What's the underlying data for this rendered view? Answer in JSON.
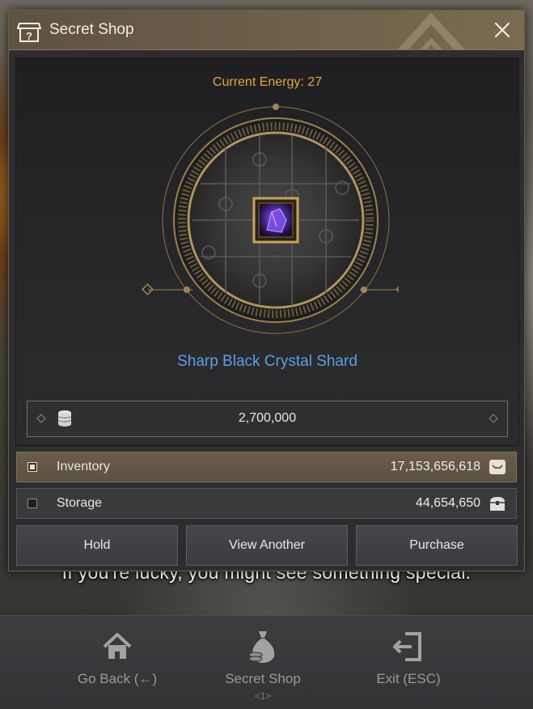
{
  "window": {
    "title": "Secret Shop",
    "title_icon": "shop-icon",
    "close_icon": "close-icon"
  },
  "shop": {
    "energy_label": "Current Energy: 27",
    "item_name": "Sharp Black Crystal Shard",
    "item_icon": "crystal-shard-icon",
    "price": "2,700,000",
    "price_icon": "silver-coins-icon"
  },
  "payment": {
    "inventory": {
      "label": "Inventory",
      "amount": "17,153,656,618",
      "checked": true,
      "icon": "inventory-bag-icon"
    },
    "storage": {
      "label": "Storage",
      "amount": "44,654,650",
      "checked": false,
      "icon": "storage-chest-icon"
    }
  },
  "buttons": {
    "hold": "Hold",
    "view_another": "View Another",
    "purchase": "Purchase"
  },
  "subtitle": "If you're lucky, you might see something special.",
  "bottom_bar": [
    {
      "label": "Go Back (←)",
      "icon": "home-icon"
    },
    {
      "label": "Secret Shop",
      "icon": "money-bag-icon",
      "sub": "<1>"
    },
    {
      "label": "Exit (ESC)",
      "icon": "exit-icon"
    }
  ],
  "colors": {
    "energy": "#e0a840",
    "item_name": "#5f9ee0",
    "frame_gold": "#a08655"
  }
}
